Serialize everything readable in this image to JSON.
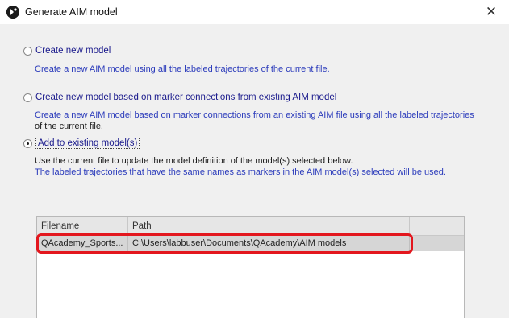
{
  "window": {
    "title": "Generate AIM model",
    "close_label": "✕"
  },
  "options": [
    {
      "label": "Create new model",
      "selected": false,
      "description": [
        "Create a new AIM model using all the labeled trajectories of the current file."
      ]
    },
    {
      "label": "Create new model based on marker connections from existing AIM model",
      "selected": false,
      "description": [
        "Create a new AIM model based on marker connections from an existing AIM file using all the labeled trajectories",
        "of the current file."
      ]
    },
    {
      "label": "Add to existing model(s)",
      "selected": true,
      "description": [
        "Use the current file to update the model definition of the model(s) selected below.",
        "The labeled trajectories that have the same names as markers in the AIM model(s) selected will be used."
      ]
    }
  ],
  "table": {
    "columns": [
      "Filename",
      "Path"
    ],
    "rows": [
      {
        "filename": "QAcademy_Sports...",
        "path": "C:\\Users\\labbuser\\Documents\\QAcademy\\AIM models",
        "selected": true
      }
    ]
  },
  "colors": {
    "highlight": "#e3171e",
    "link_text": "#2b3bbb",
    "selected_row": "#d6d6d6"
  }
}
